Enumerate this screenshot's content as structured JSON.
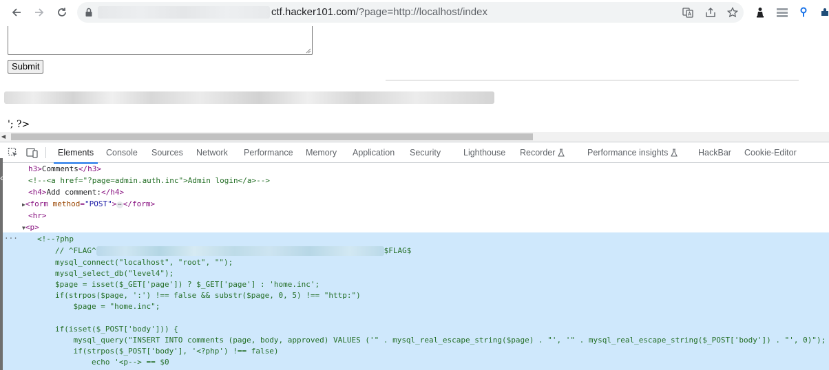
{
  "browser": {
    "url_host": "ctf.hacker101.com",
    "url_path": "/?page=http://localhost/index"
  },
  "page": {
    "submit_label": "Submit",
    "php_tail": "'; ?>"
  },
  "devtools": {
    "tabs": [
      {
        "label": "Elements"
      },
      {
        "label": "Console"
      },
      {
        "label": "Sources"
      },
      {
        "label": "Network"
      },
      {
        "label": "Performance"
      },
      {
        "label": "Memory"
      },
      {
        "label": "Application"
      },
      {
        "label": "Security"
      },
      {
        "label": "Lighthouse"
      },
      {
        "label": "Recorder"
      },
      {
        "label": "Performance insights"
      },
      {
        "label": "HackBar"
      },
      {
        "label": "Cookie-Editor"
      }
    ],
    "active_tab": "Elements",
    "dom": {
      "h3_text": "Comments",
      "admin_comment": "<!--<a href=\"?page=admin.auth.inc\">Admin login</a>-->",
      "h4_text": "Add comment:",
      "form_method": "\"POST\"",
      "code_open": "<!--?php",
      "flag_prefix": "// ^FLAG^",
      "flag_suffix": "$FLAG$",
      "code_lines": [
        "mysql_connect(\"localhost\", \"root\", \"\");",
        "mysql_select_db(\"level4\");",
        "$page = isset($_GET['page']) ? $_GET['page'] : 'home.inc';",
        "if(strpos($page, ':') !== false && substr($page, 0, 5) !== \"http:\")",
        "    $page = \"home.inc\";",
        "",
        "if(isset($_POST['body'])) {",
        "    mysql_query(\"INSERT INTO comments (page, body, approved) VALUES ('\" . mysql_real_escape_string($page) . \"', '\" . mysql_real_escape_string($_POST['body']) . \"', 0)\");",
        "    if(strpos($_POST['body'], '<?php') !== false)",
        "        echo '<p--> == $0"
      ]
    }
  }
}
